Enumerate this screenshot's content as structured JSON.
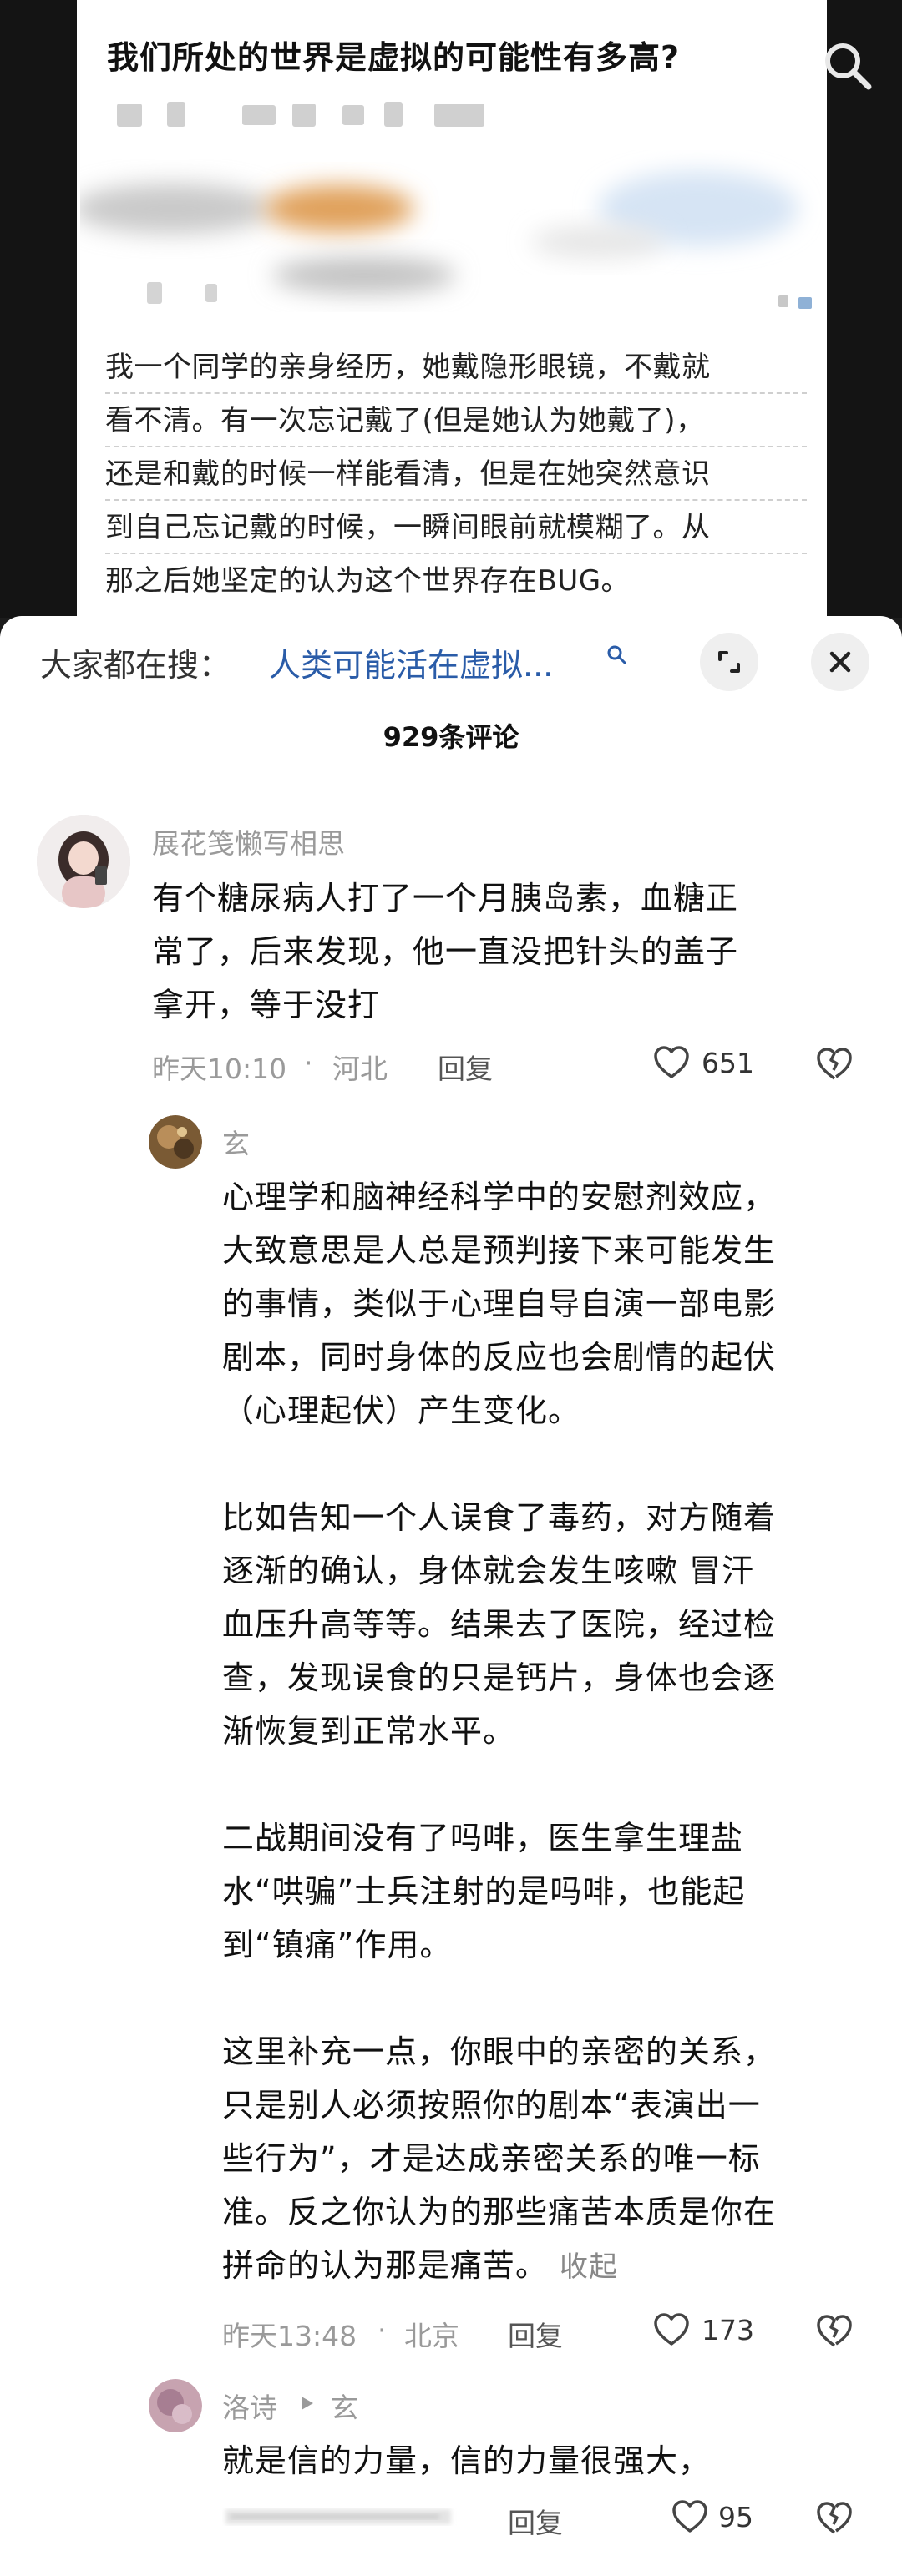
{
  "post": {
    "title": "我们所处的世界是虚拟的可能性有多高?",
    "story_lines": [
      "我一个同学的亲身经历，她戴隐形眼镜，不戴就",
      "看不清。有一次忘记戴了(但是她认为她戴了)，",
      "还是和戴的时候一样能看清，但是在她突然意识",
      "到自己忘记戴的时候，一瞬间眼前就模糊了。从",
      "那之后她坚定的认为这个世界存在BUG。"
    ]
  },
  "search": {
    "label": "大家都在搜：",
    "query": "人类可能活在虚拟..."
  },
  "comments_count": "929条评论",
  "comments": [
    {
      "user": "展花笺懒写相思",
      "lines": [
        "有个糖尿病人打了一个月胰岛素，血糖正",
        "常了，后来发现，他一直没把针头的盖子",
        "拿开，等于没打"
      ],
      "time": "昨天10:10",
      "location": "河北",
      "reply": "回复",
      "likes": "651"
    },
    {
      "user": "玄",
      "paragraphs": [
        [
          "心理学和脑神经科学中的安慰剂效应，",
          "大致意思是人总是预判接下来可能发生",
          "的事情，类似于心理自导自演一部电影",
          "剧本，同时身体的反应也会剧情的起伏",
          "（心理起伏）产生变化。"
        ],
        [
          "比如告知一个人误食了毒药，对方随着",
          "逐渐的确认，身体就会发生咳嗽 冒汗",
          "血压升高等等。结果去了医院，经过检",
          "查，发现误食的只是钙片，身体也会逐",
          "渐恢复到正常水平。"
        ],
        [
          "二战期间没有了吗啡，医生拿生理盐",
          "水“哄骗”士兵注射的是吗啡，也能起",
          "到“镇痛”作用。"
        ],
        [
          "这里补充一点，你眼中的亲密的关系，",
          "只是别人必须按照你的剧本“表演出一",
          "些行为”，才是达成亲密关系的唯一标",
          "准。反之你认为的那些痛苦本质是你在",
          "拼命的认为那是痛苦。"
        ]
      ],
      "fold": "收起",
      "time": "昨天13:48",
      "location": "北京",
      "reply": "回复",
      "likes": "173"
    },
    {
      "user": "洛诗",
      "reply_to": "玄",
      "lines": [
        "就是信的力量，信的力量很强大，"
      ],
      "reply": "回复",
      "likes": "95"
    }
  ],
  "colors": {
    "link": "#2a5ca8",
    "meta": "#9a9a9a",
    "text": "#111111"
  }
}
